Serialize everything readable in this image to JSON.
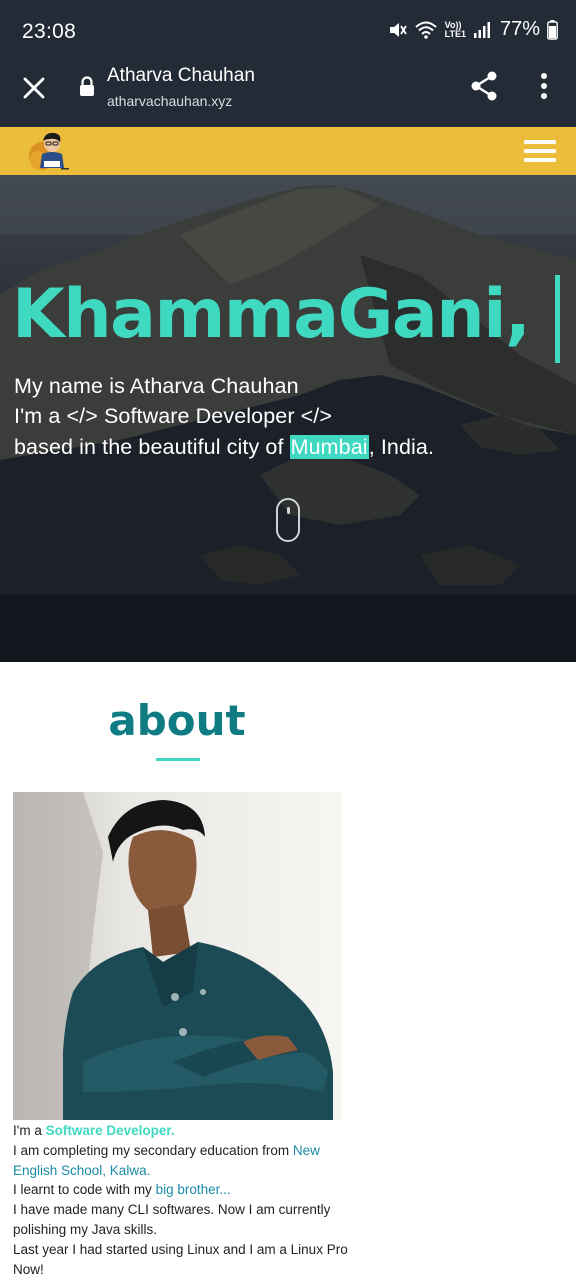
{
  "status_bar": {
    "time": "23:08",
    "battery": "77%",
    "icons": [
      "mute-icon",
      "wifi-icon",
      "volte-icon",
      "signal-icon",
      "battery-icon"
    ],
    "volte_label_top": "Vo))",
    "volte_label_bottom": "LTE1"
  },
  "browser": {
    "title": "Atharva Chauhan",
    "url": "atharvachauhan.xyz"
  },
  "nav": {
    "logo": "avatar-logo",
    "menu_icon": "hamburger-icon"
  },
  "hero": {
    "title": "KhammaGani,",
    "line1": "My name is Atharva Chauhan",
    "line2_prefix": "I'm a ",
    "line2_code_open": "</>",
    "line2_role": " Software Developer ",
    "line2_code_close": "</>",
    "line3_prefix": "based in the beautiful city of ",
    "line3_city": "Mumbai",
    "line3_suffix": ", India."
  },
  "about": {
    "heading": "about",
    "bio": {
      "l1_prefix": "I'm a ",
      "l1_role": "Software Developer.",
      "l2_prefix": "I am completing my secondary education from ",
      "l2_school": "New English School, Kalwa.",
      "l3_prefix": "I learnt to code with my ",
      "l3_link": "big brother...",
      "l4": "I have made many CLI softwares. Now I am currently polishing my Java skills.",
      "l5": "Last year I had started using Linux and I am a Linux Pro Now!"
    }
  },
  "colors": {
    "accent": "#3fd9c2",
    "nav_bg": "#ecbc3b",
    "heading": "#0f7b82",
    "chrome_bg": "#232b36"
  }
}
